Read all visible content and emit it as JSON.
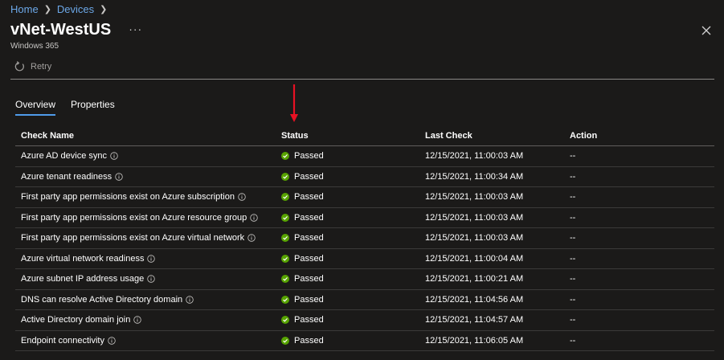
{
  "breadcrumb": {
    "items": [
      "Home",
      "Devices"
    ]
  },
  "header": {
    "title": "vNet-WestUS",
    "more": "···",
    "subtitle": "Windows 365"
  },
  "toolbar": {
    "retry_label": "Retry"
  },
  "tabs": [
    {
      "label": "Overview",
      "active": true
    },
    {
      "label": "Properties",
      "active": false
    }
  ],
  "table": {
    "columns": [
      "Check Name",
      "Status",
      "Last Check",
      "Action"
    ],
    "rows": [
      {
        "name": "Azure AD device sync",
        "status": "Passed",
        "last_check": "12/15/2021, 11:00:03 AM",
        "action": "--"
      },
      {
        "name": "Azure tenant readiness",
        "status": "Passed",
        "last_check": "12/15/2021, 11:00:34 AM",
        "action": "--"
      },
      {
        "name": "First party app permissions exist on Azure subscription",
        "status": "Passed",
        "last_check": "12/15/2021, 11:00:03 AM",
        "action": "--"
      },
      {
        "name": "First party app permissions exist on Azure resource group",
        "status": "Passed",
        "last_check": "12/15/2021, 11:00:03 AM",
        "action": "--"
      },
      {
        "name": "First party app permissions exist on Azure virtual network",
        "status": "Passed",
        "last_check": "12/15/2021, 11:00:03 AM",
        "action": "--"
      },
      {
        "name": "Azure virtual network readiness",
        "status": "Passed",
        "last_check": "12/15/2021, 11:00:04 AM",
        "action": "--"
      },
      {
        "name": "Azure subnet IP address usage",
        "status": "Passed",
        "last_check": "12/15/2021, 11:00:21 AM",
        "action": "--"
      },
      {
        "name": "DNS can resolve Active Directory domain",
        "status": "Passed",
        "last_check": "12/15/2021, 11:04:56 AM",
        "action": "--"
      },
      {
        "name": "Active Directory domain join",
        "status": "Passed",
        "last_check": "12/15/2021, 11:04:57 AM",
        "action": "--"
      },
      {
        "name": "Endpoint connectivity",
        "status": "Passed",
        "last_check": "12/15/2021, 11:06:05 AM",
        "action": "--"
      }
    ]
  },
  "colors": {
    "passed": "#57a300",
    "accent": "#4f9bea",
    "arrow": "#e81123"
  },
  "icons": {
    "breadcrumb_separator": "chevron-right-icon",
    "retry": "refresh-icon",
    "close": "close-icon",
    "info": "info-icon",
    "status": "checkmark-circle-icon",
    "annotation": "red-arrow-icon"
  }
}
